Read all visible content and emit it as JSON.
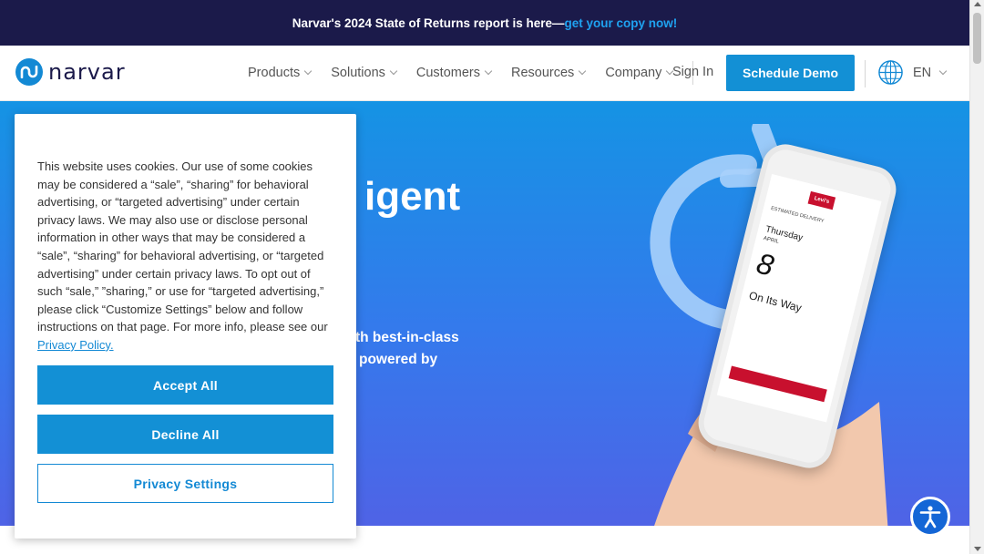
{
  "announcement": {
    "text": "Narvar's 2024 State of Returns report is here—",
    "link": "get your copy now!"
  },
  "header": {
    "logo_text": "narvar",
    "nav": [
      {
        "label": "Products"
      },
      {
        "label": "Solutions"
      },
      {
        "label": "Customers"
      },
      {
        "label": "Resources"
      },
      {
        "label": "Company"
      }
    ],
    "signin_label": "Sign In",
    "demo_label": "Schedule Demo",
    "language": "EN"
  },
  "hero": {
    "title_fragment": "igent",
    "subtitle_line1": "th best-in-class",
    "subtitle_line2": "powered by"
  },
  "phone": {
    "brand": "Levi's",
    "label": "ESTIMATED DELIVERY",
    "day": "Thursday",
    "month": "APRIL",
    "date": "8",
    "status": "On Its Way"
  },
  "cookie": {
    "text": "This website uses cookies. Our use of some cookies may be considered a “sale”, “sharing” for behavioral advertising, or “targeted advertising” under certain privacy laws. We may also use or disclose personal information in other ways that may be considered a “sale”, “sharing” for behavioral advertising, or “targeted advertising” under certain privacy laws. To opt out of such “sale,” ”sharing,” or use for “targeted advertising,” please click “Customize Settings” below and follow instructions on that page. For more info, please see our ",
    "link": "Privacy Policy.",
    "accept_label": "Accept All",
    "decline_label": "Decline All",
    "settings_label": "Privacy Settings"
  },
  "colors": {
    "navy": "#1b1a4a",
    "accent": "#1390d5",
    "hero_top": "#1593e4",
    "hero_bottom": "#4f63e6"
  }
}
